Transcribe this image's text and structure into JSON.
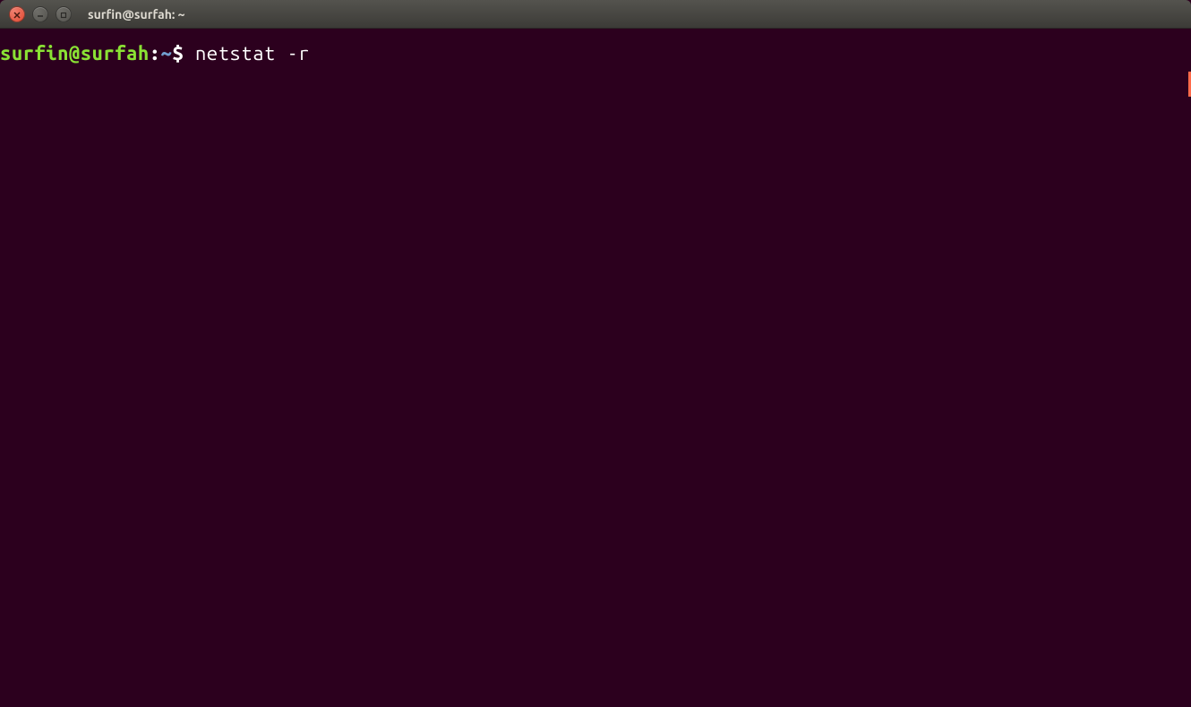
{
  "titlebar": {
    "title": "surfin@surfah: ~"
  },
  "terminal": {
    "prompt_user_host": "surfin@surfah",
    "prompt_separator": ":",
    "prompt_path": "~",
    "prompt_dollar": "$ ",
    "command": "netstat -r"
  }
}
